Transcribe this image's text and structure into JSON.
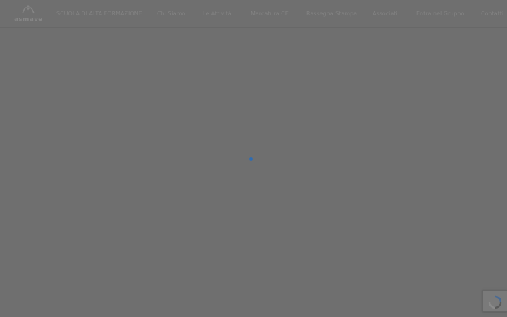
{
  "header": {
    "logo_text": "asmave",
    "nav": [
      {
        "label": "SCUOLA DI ALTA FORMAZIONE"
      },
      {
        "label": "Chi Siamo"
      },
      {
        "label": "Le Attività"
      },
      {
        "label": "Marcatura CE"
      },
      {
        "label": "Rassegna Stampa"
      },
      {
        "label": "Associati"
      },
      {
        "label": "Entra nel Gruppo"
      },
      {
        "label": "Contatti"
      }
    ]
  },
  "loader": {
    "icon": "loading-spinner-icon",
    "color": "#2d6cb3"
  },
  "recaptcha": {
    "icon": "recaptcha-icon"
  },
  "colors": {
    "overlay": "#6f6f6f",
    "accent": "#2d6cb3"
  }
}
